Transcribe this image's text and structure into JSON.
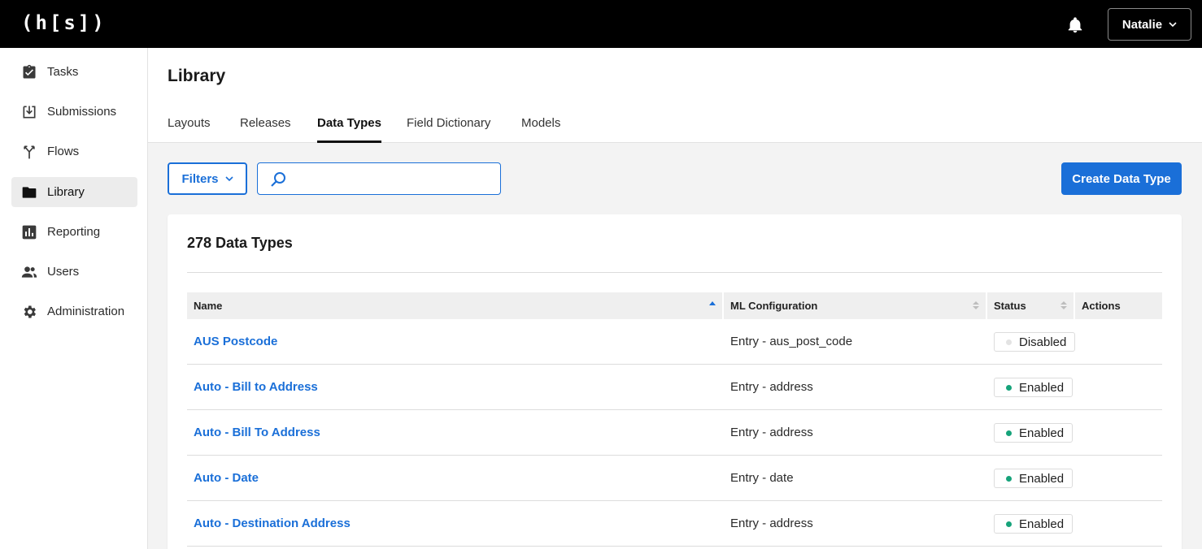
{
  "app": {
    "logo": "(h[s])"
  },
  "user": {
    "name": "Natalie"
  },
  "sidebar": {
    "items": [
      {
        "label": "Tasks",
        "icon": "clipboard-check-icon"
      },
      {
        "label": "Submissions",
        "icon": "download-tray-icon"
      },
      {
        "label": "Flows",
        "icon": "fork-icon"
      },
      {
        "label": "Library",
        "icon": "folder-icon",
        "active": true
      },
      {
        "label": "Reporting",
        "icon": "bar-chart-icon"
      },
      {
        "label": "Users",
        "icon": "users-icon"
      },
      {
        "label": "Administration",
        "icon": "gear-icon"
      }
    ]
  },
  "page": {
    "title": "Library",
    "tabs": [
      {
        "label": "Layouts"
      },
      {
        "label": "Releases"
      },
      {
        "label": "Data Types",
        "active": true
      },
      {
        "label": "Field Dictionary"
      },
      {
        "label": "Models"
      }
    ]
  },
  "toolbar": {
    "filters_label": "Filters",
    "search_value": "",
    "search_placeholder": "",
    "create_label": "Create Data Type"
  },
  "table": {
    "count_title": "278 Data Types",
    "columns": [
      "Name",
      "ML Configuration",
      "Status",
      "Actions"
    ],
    "rows": [
      {
        "name": "AUS Postcode",
        "ml": "Entry - aus_post_code",
        "status": "Disabled"
      },
      {
        "name": "Auto - Bill to Address",
        "ml": "Entry - address",
        "status": "Enabled"
      },
      {
        "name": "Auto - Bill To Address",
        "ml": "Entry - address",
        "status": "Enabled"
      },
      {
        "name": "Auto - Date",
        "ml": "Entry - date",
        "status": "Enabled"
      },
      {
        "name": "Auto - Destination Address",
        "ml": "Entry - address",
        "status": "Enabled"
      }
    ]
  },
  "colors": {
    "accent": "#1a6fd8",
    "enabled": "#16a37a",
    "disabled": "#d9d9d9",
    "topbar": "#000000"
  }
}
